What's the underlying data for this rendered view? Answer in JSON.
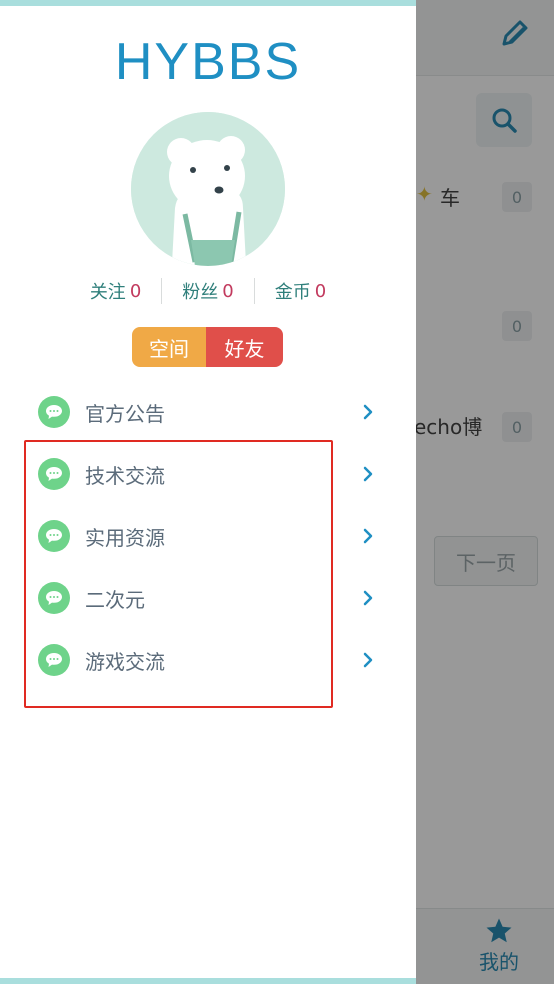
{
  "background": {
    "fragment_1": "车",
    "fragment_2": "echo博",
    "counts": [
      "0",
      "0",
      "0"
    ],
    "next_page": "下一页",
    "tab_my": "我的"
  },
  "drawer": {
    "brand": "HYBBS",
    "stats": [
      {
        "label": "关注",
        "value": "0"
      },
      {
        "label": "粉丝",
        "value": "0"
      },
      {
        "label": "金币",
        "value": "0"
      }
    ],
    "buttons": {
      "space": "空间",
      "friends": "好友"
    },
    "menu": [
      {
        "label": "官方公告",
        "icon": "chat-bubble-icon"
      },
      {
        "label": "技术交流",
        "icon": "chat-bubble-icon"
      },
      {
        "label": "实用资源",
        "icon": "chat-bubble-icon"
      },
      {
        "label": "二次元",
        "icon": "chat-bubble-icon"
      },
      {
        "label": "游戏交流",
        "icon": "chat-bubble-icon"
      }
    ]
  },
  "colors": {
    "brand": "#1f8fc3",
    "stat_value": "#c23a5e",
    "space_button": "#f0a946",
    "friends_button": "#e04f4a",
    "menu_icon": "#6ed38a",
    "highlight_box": "#e02a22",
    "drawer_accent": "#a9dedd"
  }
}
